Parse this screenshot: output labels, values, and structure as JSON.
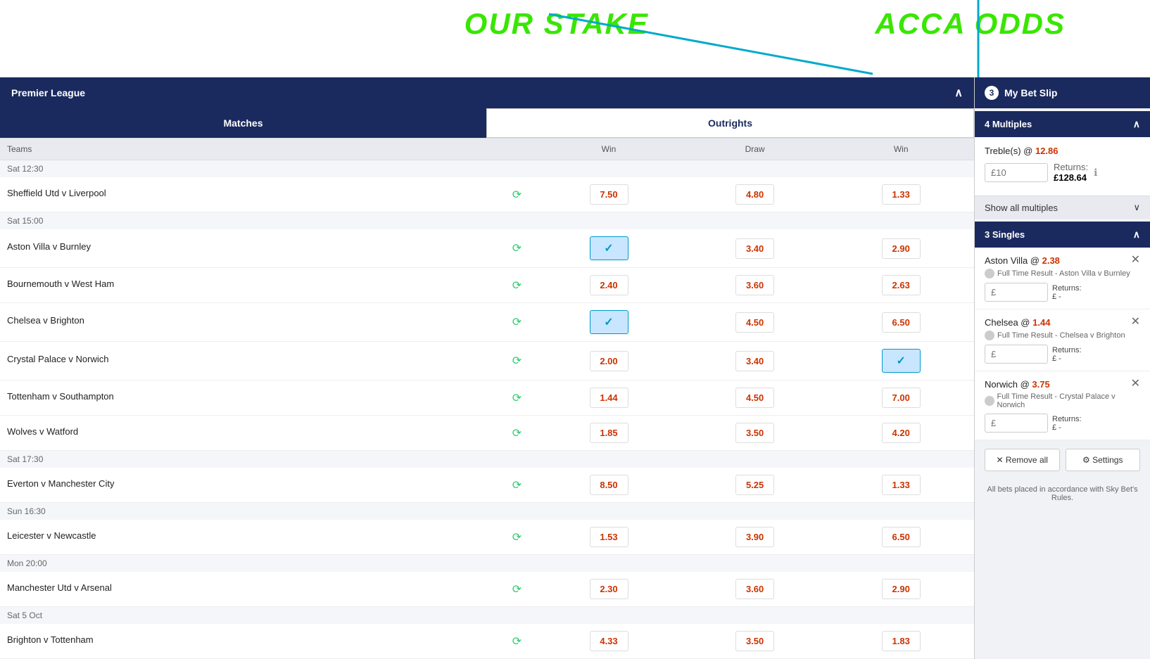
{
  "annotations": {
    "our_stake": "OUR STAKE",
    "acca_odds": "ACCA ODDS"
  },
  "league": {
    "title": "Premier League"
  },
  "tabs": {
    "matches": "Matches",
    "outrights": "Outrights"
  },
  "table": {
    "col_teams": "Teams",
    "col_win1": "Win",
    "col_draw": "Draw",
    "col_win2": "Win"
  },
  "matches": [
    {
      "time": "Sat 12:30",
      "games": [
        {
          "teams": "Sheffield Utd v Liverpool",
          "win1": "7.50",
          "draw": "4.80",
          "win2": "1.33",
          "selected": ""
        }
      ]
    },
    {
      "time": "Sat 15:00",
      "games": [
        {
          "teams": "Aston Villa v Burnley",
          "win1": "check",
          "draw": "3.40",
          "win2": "2.90",
          "selected": "win1"
        },
        {
          "teams": "Bournemouth v West Ham",
          "win1": "2.40",
          "draw": "3.60",
          "win2": "2.63",
          "selected": ""
        },
        {
          "teams": "Chelsea v Brighton",
          "win1": "check",
          "draw": "4.50",
          "win2": "6.50",
          "selected": "win1"
        },
        {
          "teams": "Crystal Palace v Norwich",
          "win1": "2.00",
          "draw": "3.40",
          "win2": "check",
          "selected": "win2"
        },
        {
          "teams": "Tottenham v Southampton",
          "win1": "1.44",
          "draw": "4.50",
          "win2": "7.00",
          "selected": ""
        },
        {
          "teams": "Wolves v Watford",
          "win1": "1.85",
          "draw": "3.50",
          "win2": "4.20",
          "selected": ""
        }
      ]
    },
    {
      "time": "Sat 17:30",
      "games": [
        {
          "teams": "Everton v Manchester City",
          "win1": "8.50",
          "draw": "5.25",
          "win2": "1.33",
          "selected": ""
        }
      ]
    },
    {
      "time": "Sun 16:30",
      "games": [
        {
          "teams": "Leicester v Newcastle",
          "win1": "1.53",
          "draw": "3.90",
          "win2": "6.50",
          "selected": ""
        }
      ]
    },
    {
      "time": "Mon 20:00",
      "games": [
        {
          "teams": "Manchester Utd v Arsenal",
          "win1": "2.30",
          "draw": "3.60",
          "win2": "2.90",
          "selected": ""
        }
      ]
    },
    {
      "time": "Sat 5 Oct",
      "games": [
        {
          "teams": "Brighton v Tottenham",
          "win1": "4.33",
          "draw": "3.50",
          "win2": "1.83",
          "selected": ""
        }
      ]
    }
  ],
  "betslip": {
    "title": "My Bet Slip",
    "count": "3",
    "multiples_label": "4 Multiples",
    "treble_label": "Treble(s) @",
    "treble_odds": "12.86",
    "stake_placeholder": "£10",
    "returns_label": "Returns:",
    "returns_value": "£128.64",
    "show_all_label": "Show all multiples",
    "singles_label": "3 Singles",
    "singles": [
      {
        "name": "Aston Villa @",
        "odds": "2.38",
        "desc": "Full Time Result - Aston Villa v Burnley",
        "stake_placeholder": "£",
        "returns_label": "Returns:",
        "returns_value": "£ -"
      },
      {
        "name": "Chelsea @",
        "odds": "1.44",
        "desc": "Full Time Result - Chelsea v Brighton",
        "stake_placeholder": "£",
        "returns_label": "Returns:",
        "returns_value": "£ -"
      },
      {
        "name": "Norwich @",
        "odds": "3.75",
        "desc": "Full Time Result - Crystal Palace v Norwich",
        "stake_placeholder": "£",
        "returns_label": "Returns:",
        "returns_value": "£ -"
      }
    ],
    "remove_all": "✕ Remove all",
    "settings": "⚙ Settings",
    "footer": "All bets placed in accordance with Sky Bet's Rules."
  }
}
